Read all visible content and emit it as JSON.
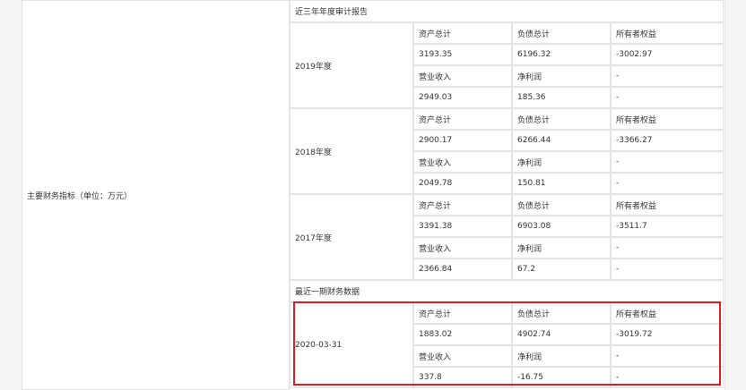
{
  "left_label": "主要财务指标（单位：万元）",
  "section_annual": "近三年年度审计报告",
  "section_latest": "最近一期财务数据",
  "headers": {
    "total_assets": "资产总计",
    "total_liabilities": "负债总计",
    "owners_equity": "所有者权益",
    "revenue": "营业收入",
    "net_profit": "净利润"
  },
  "years": [
    {
      "label": "2019年度",
      "total_assets": "3193.35",
      "total_liabilities": "6196.32",
      "owners_equity": "-3002.97",
      "revenue": "2949.03",
      "net_profit": "185.36",
      "blank": "-"
    },
    {
      "label": "2018年度",
      "total_assets": "2900.17",
      "total_liabilities": "6266.44",
      "owners_equity": "-3366.27",
      "revenue": "2049.78",
      "net_profit": "150.81",
      "blank": "-"
    },
    {
      "label": "2017年度",
      "total_assets": "3391.38",
      "total_liabilities": "6903.08",
      "owners_equity": "-3511.7",
      "revenue": "2366.84",
      "net_profit": "67.2",
      "blank": "-"
    }
  ],
  "latest": {
    "label": "2020-03-31",
    "total_assets": "1883.02",
    "total_liabilities": "4902.74",
    "owners_equity": "-3019.72",
    "revenue": "337.8",
    "net_profit": "-16.75",
    "blank": "-"
  }
}
